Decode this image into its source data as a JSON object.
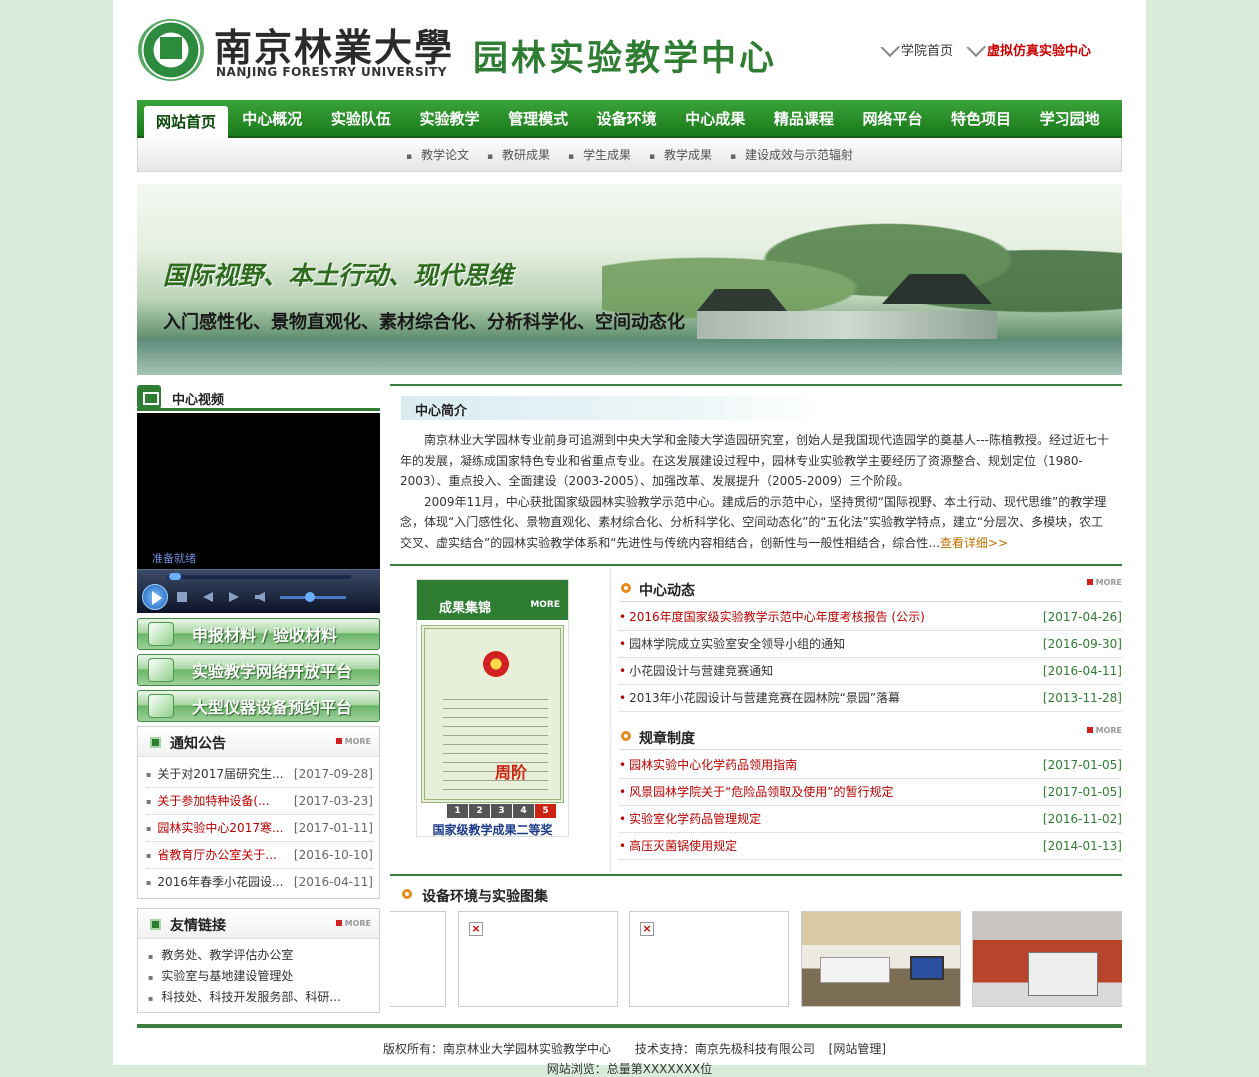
{
  "header": {
    "logo_cn": "南京林業大學",
    "logo_en": "NANJING FORESTRY UNIVERSITY",
    "site_title": "园林实验教学中心",
    "links": [
      "学院首页",
      "虚拟仿真实验中心"
    ]
  },
  "nav": {
    "items": [
      "网站首页",
      "中心概况",
      "实验队伍",
      "实验教学",
      "管理模式",
      "设备环境",
      "中心成果",
      "精品课程",
      "网络平台",
      "特色项目",
      "学习园地"
    ]
  },
  "subnav": [
    "教学论文",
    "教研成果",
    "学生成果",
    "教学成果",
    "建设成效与示范辐射"
  ],
  "banner": {
    "line1": "国际视野、本土行动、现代思维",
    "line2": "入门感性化、景物直观化、素材综合化、分析科学化、空间动态化"
  },
  "video": {
    "title": "中心视频",
    "status": "准备就绪"
  },
  "buttons": [
    "申报材料 / 验收材料",
    "实验教学网络开放平台",
    "大型仪器设备预约平台"
  ],
  "notice": {
    "title": "通知公告",
    "more": "MORE",
    "items": [
      {
        "title": "关于对2017届研究生...",
        "date": "[2017-09-28]",
        "red": false
      },
      {
        "title": "关于参加特种设备(...",
        "date": "[2017-03-23]",
        "red": true
      },
      {
        "title": "园林实验中心2017寒...",
        "date": "[2017-01-11]",
        "red": true
      },
      {
        "title": "省教育厅办公室关于...",
        "date": "[2016-10-10]",
        "red": true
      },
      {
        "title": "2016年春季小花园设...",
        "date": "[2016-04-11]",
        "red": false
      }
    ]
  },
  "links_box": {
    "title": "友情链接",
    "more": "MORE",
    "items": [
      "教务处、教学评估办公室",
      "实验室与基地建设管理处",
      "科技处、科技开发服务部、科研..."
    ]
  },
  "intro": {
    "title": "中心简介",
    "p1": "南京林业大学园林专业前身可追溯到中央大学和金陵大学造园研究室，创始人是我国现代造园学的奠基人---陈植教授。经过近七十年的发展，凝练成国家特色专业和省重点专业。在这发展建设过程中，园林专业实验教学主要经历了资源整合、规划定位（1980-2003）、重点投入、全面建设（2003-2005）、加强改革、发展提升（2005-2009）三个阶段。",
    "p2": "2009年11月，中心获批国家级园林实验教学示范中心。建成后的示范中心，坚持贯彻“国际视野、本土行动、现代思维”的教学理念，体现“入门感性化、景物直观化、素材综合化、分析科学化、空间动态化”的“五化法”实验教学特点，建立“分层次、多模块，农工交叉、虚实结合”的园林实验教学体系和“先进性与传统内容相结合，创新性与一般性相结合，综合性...",
    "detail": "查看详细>>"
  },
  "award": {
    "header": "成果集锦",
    "more": "MORE",
    "cert_stamp": "周阶",
    "pages": [
      "1",
      "2",
      "3",
      "4",
      "5"
    ],
    "caption": "国家级教学成果二等奖"
  },
  "news": {
    "title": "中心动态",
    "more": "MORE",
    "items": [
      {
        "title": "2016年度国家级实验教学示范中心年度考核报告 (公示)",
        "date": "[2017-04-26]",
        "red": true
      },
      {
        "title": "园林学院成立实验室安全领导小组的通知",
        "date": "[2016-09-30]",
        "red": false
      },
      {
        "title": "小花园设计与营建竞赛通知",
        "date": "[2016-04-11]",
        "red": false
      },
      {
        "title": "2013年小花园设计与营建竞赛在园林院“景园”落幕",
        "date": "[2013-11-28]",
        "red": false
      }
    ]
  },
  "rules": {
    "title": "规章制度",
    "more": "MORE",
    "items": [
      {
        "title": "园林实验中心化学药品领用指南",
        "date": "[2017-01-05]",
        "red": true
      },
      {
        "title": "风景园林学院关于“危险品领取及使用”的暂行规定",
        "date": "[2017-01-05]",
        "red": true
      },
      {
        "title": "实验室化学药品管理规定",
        "date": "[2016-11-02]",
        "red": true
      },
      {
        "title": "高压灭菌锅使用规定",
        "date": "[2014-01-13]",
        "red": true
      }
    ]
  },
  "gallery": {
    "title": "设备环境与实验图集"
  },
  "footer": {
    "copyright": "版权所有：南京林业大学园林实验教学中心",
    "support": "技术支持：南京先极科技有限公司",
    "admin": "[网站管理]",
    "icp": "网站浏览：总量第XXXXXXX位"
  }
}
